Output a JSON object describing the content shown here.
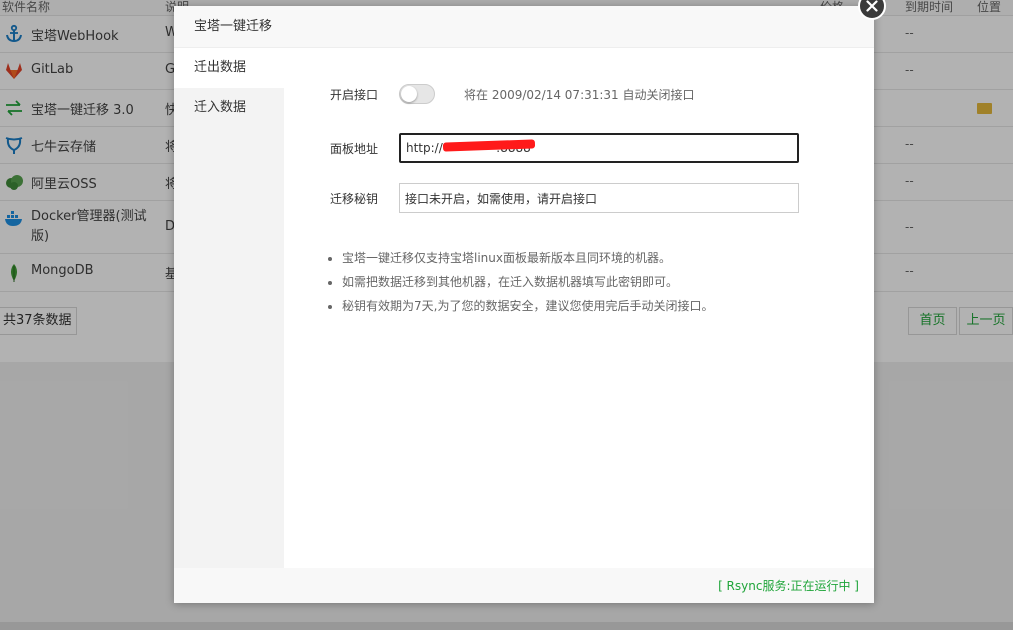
{
  "background": {
    "headers": [
      "软件名称",
      "说明",
      "价格",
      "到期时间",
      "位置"
    ],
    "rows": [
      {
        "name": "宝塔WebHook",
        "desc": "W",
        "expiry": "--",
        "icon": "anchor-icon"
      },
      {
        "name": "GitLab",
        "desc": "G",
        "expiry": "--",
        "icon": "gitlab-icon"
      },
      {
        "name": "宝塔一键迁移 3.0",
        "desc": "快",
        "expiry": "",
        "icon": "transfer-arrows-icon"
      },
      {
        "name": "七牛云存储",
        "desc": "将",
        "expiry": "--",
        "icon": "qiniu-icon"
      },
      {
        "name": "阿里云OSS",
        "desc": "将",
        "expiry": "--",
        "icon": "aliyun-icon"
      },
      {
        "name": "Docker管理器(测试版)",
        "desc": "D",
        "expiry": "--",
        "icon": "docker-icon"
      },
      {
        "name": "MongoDB",
        "desc": "基",
        "expiry": "--",
        "icon": "mongodb-leaf-icon"
      }
    ],
    "total_label": "共37条数据",
    "pagination": {
      "first": "首页",
      "prev": "上一页"
    }
  },
  "modal": {
    "title": "宝塔一键迁移",
    "menu": [
      {
        "label": "迁出数据",
        "active": true
      },
      {
        "label": "迁入数据",
        "active": false
      }
    ],
    "form": {
      "toggle_label": "开启接口",
      "toggle_on": false,
      "toggle_note": "将在 2009/02/14 07:31:31 自动关闭接口",
      "address_label": "面板地址",
      "address_value": "http://              :8888",
      "secret_label": "迁移秘钥",
      "secret_value": "接口未开启，如需使用，请开启接口"
    },
    "tips": [
      "宝塔一键迁移仅支持宝塔linux面板最新版本且同环境的机器。",
      "如需把数据迁移到其他机器，在迁入数据机器填写此密钥即可。",
      "秘钥有效期为7天,为了您的数据安全，建议您使用完后手动关闭接口。"
    ],
    "footer_status": "[ Rsync服务:正在运行中 ]"
  },
  "colors": {
    "accent_green": "#20a53a",
    "redaction": "#ff1a1a",
    "overlay": "rgba(0,0,0,0.3)"
  }
}
